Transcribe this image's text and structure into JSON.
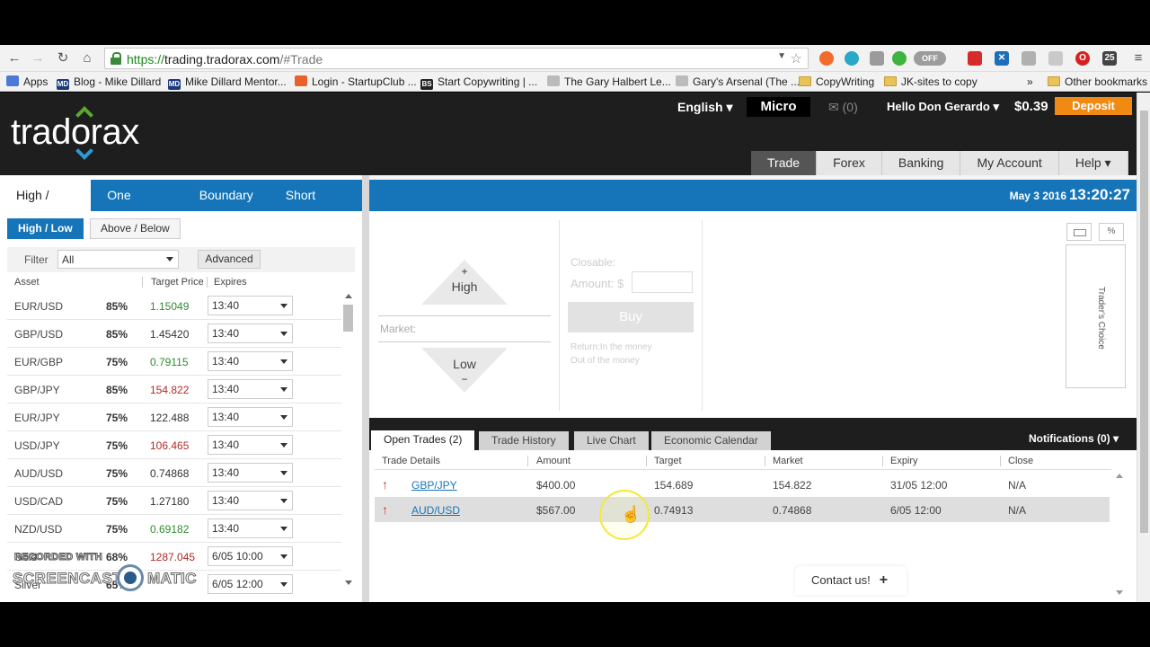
{
  "browser": {
    "url_protocol": "https://",
    "url_host": "trading.tradorax.com",
    "url_rest": "/#Trade",
    "ext_off_label": "OFF",
    "ext_count": "25"
  },
  "bookmarks": {
    "apps": "Apps",
    "items": [
      "Blog - Mike Dillard",
      "Mike Dillard Mentor...",
      "Login - StartupClub ...",
      "Start Copywriting | ...",
      "The Gary Halbert Le...",
      "Gary's Arsenal (The ...",
      "CopyWriting",
      "JK-sites to copy"
    ],
    "md_badge": "MD",
    "bs_badge": "BS",
    "more": "»",
    "other": "Other bookmarks"
  },
  "header": {
    "logo": "tradorax",
    "language": "English ▾",
    "account_type": "Micro",
    "mail": "✉ (0)",
    "greeting": "Hello Don Gerardo ▾",
    "balance": "$0.39",
    "deposit": "Deposit",
    "nav": [
      "Trade",
      "Forex",
      "Banking",
      "My Account",
      "Help ▾"
    ]
  },
  "left": {
    "type_tabs": [
      "High / Low",
      "One Touch",
      "Boundary",
      "Short Term"
    ],
    "sub_tabs": [
      "High / Low",
      "Above / Below"
    ],
    "filter_label": "Filter",
    "filter_value": "All",
    "advanced": "Advanced",
    "col_asset": "Asset",
    "col_target": "Target Price",
    "col_expires": "Expires",
    "assets": [
      {
        "name": "EUR/USD",
        "pct": "85%",
        "price": "1.15049",
        "color": "#2e8b2e",
        "expires": "13:40"
      },
      {
        "name": "GBP/USD",
        "pct": "85%",
        "price": "1.45420",
        "color": "#333333",
        "expires": "13:40"
      },
      {
        "name": "EUR/GBP",
        "pct": "75%",
        "price": "0.79115",
        "color": "#2e8b2e",
        "expires": "13:40"
      },
      {
        "name": "GBP/JPY",
        "pct": "85%",
        "price": "154.822",
        "color": "#b32828",
        "expires": "13:40"
      },
      {
        "name": "EUR/JPY",
        "pct": "75%",
        "price": "122.488",
        "color": "#333333",
        "expires": "13:40"
      },
      {
        "name": "USD/JPY",
        "pct": "75%",
        "price": "106.465",
        "color": "#b32828",
        "expires": "13:40"
      },
      {
        "name": "AUD/USD",
        "pct": "75%",
        "price": "0.74868",
        "color": "#333333",
        "expires": "13:40"
      },
      {
        "name": "USD/CAD",
        "pct": "75%",
        "price": "1.27180",
        "color": "#333333",
        "expires": "13:40"
      },
      {
        "name": "NZD/USD",
        "pct": "75%",
        "price": "0.69182",
        "color": "#2e8b2e",
        "expires": "13:40"
      },
      {
        "name": "Gold",
        "pct": "68%",
        "price": "1287.045",
        "color": "#b32828",
        "expires": "6/05 10:00"
      },
      {
        "name": "Silver",
        "pct": "65%",
        "price": "",
        "color": "#333333",
        "expires": "6/05 12:00"
      }
    ]
  },
  "trade": {
    "date": "May 3 2016",
    "time": "13:20:27",
    "high": "High",
    "high_sym": "+",
    "low": "Low",
    "low_sym": "−",
    "market": "Market:",
    "closable": "Closable:",
    "amount": "Amount: $",
    "buy": "Buy",
    "return_in": "Return:In the money",
    "return_out": "Out of the money",
    "traders_choice": "Trader's Choice",
    "pct_icon": "%"
  },
  "trades": {
    "tabs": [
      "Open Trades (2)",
      "Trade History",
      "Live Chart",
      "Economic Calendar"
    ],
    "notifications": "Notifications (0) ▾",
    "columns": [
      "Trade Details",
      "Amount",
      "Target",
      "Market",
      "Expiry",
      "Close"
    ],
    "rows": [
      {
        "asset": "GBP/JPY",
        "amount": "$400.00",
        "target": "154.689",
        "market": "154.822",
        "expiry": "31/05 12:00",
        "close": "N/A"
      },
      {
        "asset": "AUD/USD",
        "amount": "$567.00",
        "target": "0.74913",
        "market": "0.74868",
        "expiry": "6/05 12:00",
        "close": "N/A"
      }
    ],
    "contact": "Contact us!",
    "contact_plus": "+"
  },
  "watermark": {
    "line1": "RECORDED WITH",
    "line2": "SCREENCAST",
    "line3": "MATIC"
  },
  "colors": {
    "brand_blue": "#1575b8",
    "deposit_orange": "#f08a12",
    "up_green": "#2e8b2e",
    "down_red": "#b32828"
  }
}
